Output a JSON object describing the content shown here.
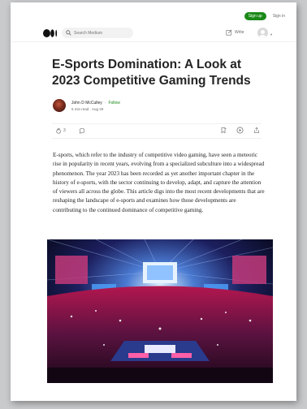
{
  "header": {
    "signup_label": "Sign up",
    "signin_label": "Sign in"
  },
  "nav": {
    "search_placeholder": "Search Medium",
    "write_label": "Write"
  },
  "article": {
    "title": "E-Sports Domination: A Look at 2023 Competitive Gaming Trends",
    "author": "John D McCulley",
    "separator": "·",
    "follow_label": "Follow",
    "read_time": "5 min read",
    "date": "Aug 29",
    "clap_count": "3",
    "body": "E-sports, which refer to the industry of competitive video gaming, have seen a meteoric rise in popularity in recent years, evolving from a specialized subculture into a widespread phenomenon. The year 2023 has been recorded as yet another important chapter in the history of e-sports, with the sector continuing to develop, adapt, and capture the attention of viewers all across the globe. This article digs into the most recent developments that are reshaping the landscape of e-sports and examines how those developments are contributing to the continued dominance of competitive gaming."
  },
  "colors": {
    "accent_green": "#1a8917",
    "text_primary": "#242424",
    "text_secondary": "#6b6b6b"
  },
  "icons": [
    "medium-logo-icon",
    "search-icon",
    "write-icon",
    "avatar-icon",
    "chevron-down-icon",
    "clap-icon",
    "comment-icon",
    "bookmark-icon",
    "play-icon",
    "share-icon"
  ]
}
